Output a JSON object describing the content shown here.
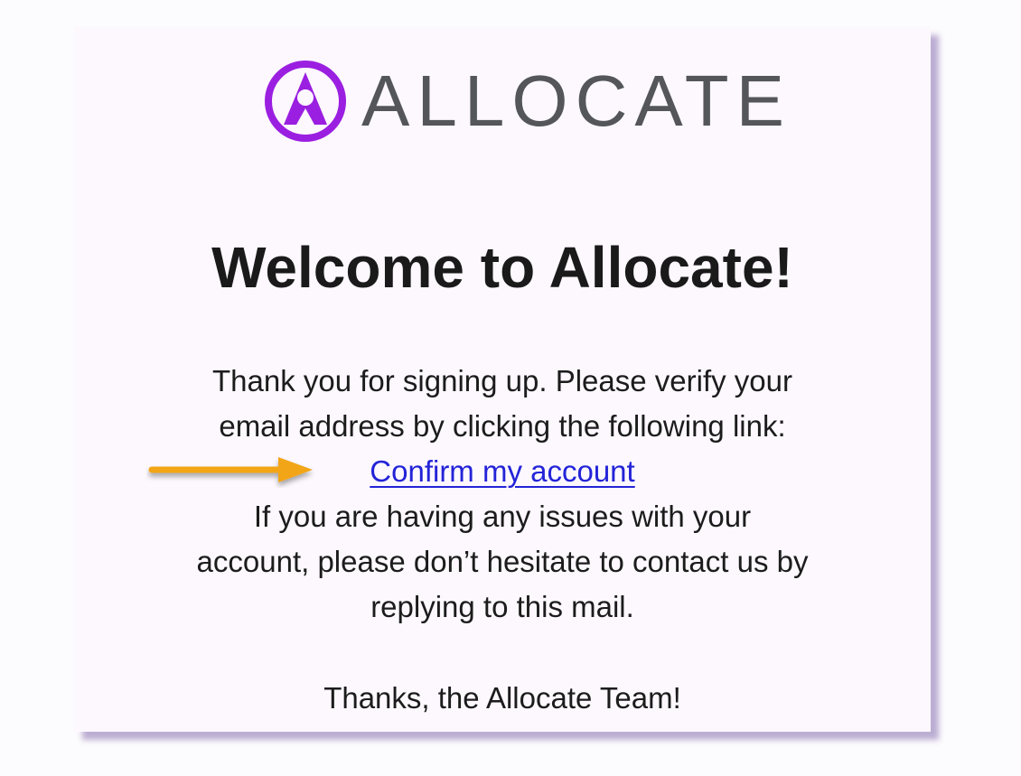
{
  "logo": {
    "mark_icon": "allocate-logo-icon",
    "brand_text": "ALLOCATE",
    "brand_color": "#9b1fe0",
    "text_color": "#545659"
  },
  "email": {
    "heading": "Welcome to Allocate!",
    "intro_lines": [
      "Thank you for signing up. Please verify your",
      "email address by clicking the following link:"
    ],
    "confirm_link": "Confirm my account",
    "issues_lines": [
      "If you are having any issues with your",
      "account, please don’t hesitate to contact us by",
      "replying to this mail."
    ],
    "signoff": "Thanks, the Allocate Team!"
  },
  "annotation": {
    "icon": "arrow-right-icon",
    "color": "#f2a516"
  },
  "colors": {
    "card_background": "#fcf8fe",
    "link": "#2323d8",
    "shadow": "#6e50a0"
  }
}
